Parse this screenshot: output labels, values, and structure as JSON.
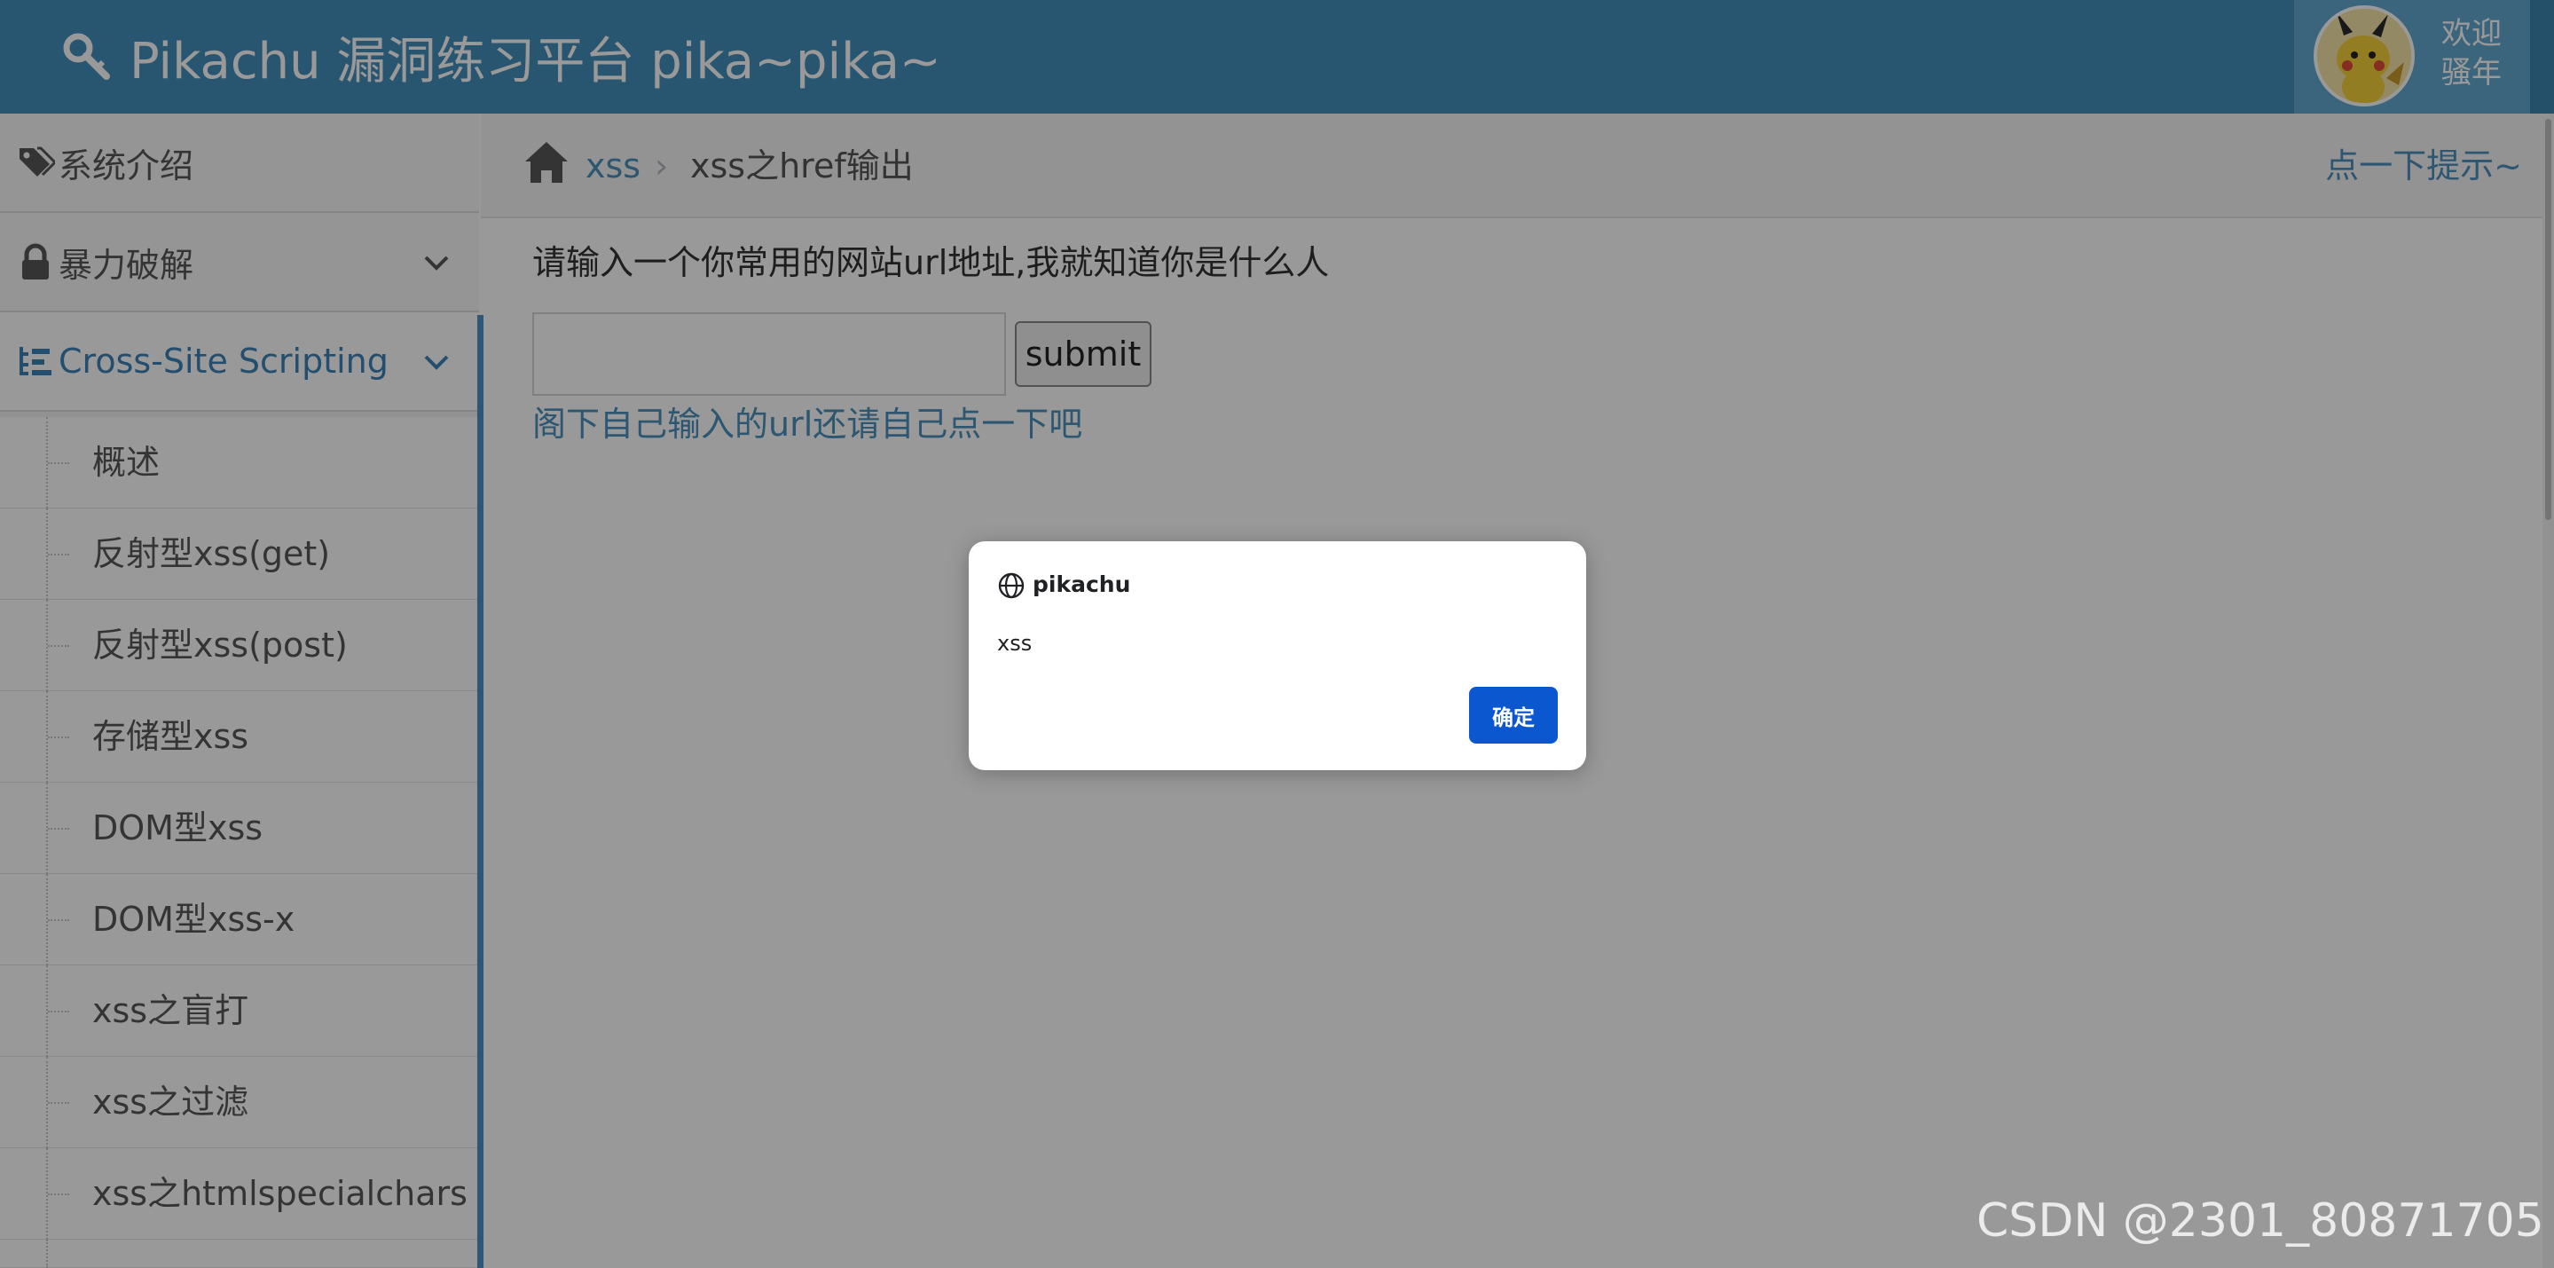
{
  "header": {
    "title": "Pikachu 漏洞练习平台 pika~pika~",
    "welcome_line1": "欢迎",
    "welcome_line2": "骚年",
    "avatar_icon": "pikachu-avatar",
    "colors": {
      "bar": "#438eb9",
      "user_area": "#62a8d1"
    }
  },
  "sidebar": {
    "items": [
      {
        "label": "系统介绍",
        "icon": "tags-icon"
      },
      {
        "label": "暴力破解",
        "icon": "lock-icon",
        "chevron": "chevron-down-icon"
      },
      {
        "label": "Cross-Site Scripting",
        "icon": "list-tree-icon",
        "chevron": "chevron-down-icon",
        "active": true
      }
    ],
    "subitems": [
      "概述",
      "反射型xss(get)",
      "反射型xss(post)",
      "存储型xss",
      "DOM型xss",
      "DOM型xss-x",
      "xss之盲打",
      "xss之过滤",
      "xss之htmlspecialchars"
    ],
    "active_color": "#3d82b8"
  },
  "breadcrumb": {
    "home_icon": "home-icon",
    "link": "xss",
    "separator": "›",
    "current": "xss之href输出",
    "hint": "点一下提示~"
  },
  "main": {
    "prompt": "请输入一个你常用的网站url地址,我就知道你是什么人",
    "input_value": "",
    "submit_label": "submit",
    "result_link": "阁下自己输入的url还请自己点一下吧"
  },
  "dialog": {
    "origin": "pikachu",
    "origin_icon": "globe-icon",
    "message": "xss",
    "ok_label": "确定",
    "ok_color": "#0b57d0"
  },
  "watermark": "CSDN @2301_80871705"
}
